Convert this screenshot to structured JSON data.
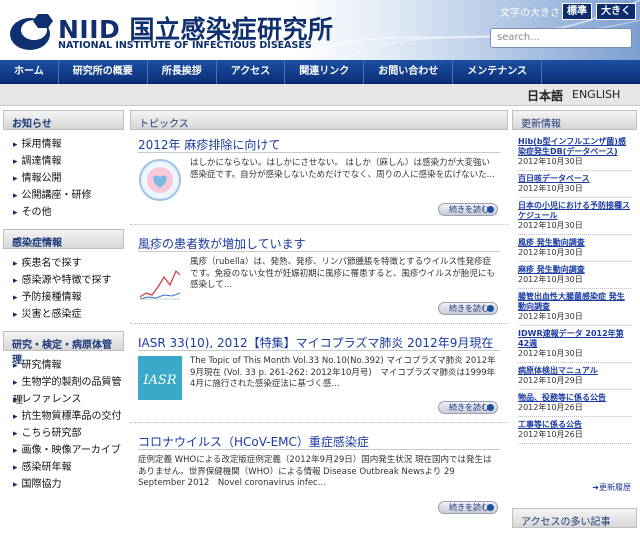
{
  "header": {
    "logo_name": "NIID 国立感染症研究所",
    "logo_sub": "NATIONAL INSTITUTE OF INFECTIOUS DISEASES",
    "font_size_label": "文字の大きさ",
    "font_standard": "標準",
    "font_large": "大きく",
    "search_placeholder": "search..."
  },
  "nav": [
    "ホーム",
    "研究所の概要",
    "所長挨拶",
    "アクセス",
    "関連リンク",
    "お問い合わせ",
    "メンテナンス"
  ],
  "lang": {
    "ja": "日本語",
    "en": "ENGLISH"
  },
  "left": {
    "sections": [
      {
        "title": "お知らせ",
        "items": [
          "採用情報",
          "調達情報",
          "情報公開",
          "公開講座・研修",
          "その他"
        ]
      },
      {
        "title": "感染症情報",
        "items": [
          "疾患名で探す",
          "感染源や特徴で探す",
          "予防接種情報",
          "災害と感染症"
        ]
      },
      {
        "title": "研究・検定・病原体管理",
        "items": [
          "研究情報",
          "生物学的製剤の品質管理",
          "レファレンス",
          "抗生物質標準品の交付",
          "こちら研究部",
          "画像・映像アーカイブ",
          "感染研年報",
          "国際協力"
        ]
      }
    ]
  },
  "topics": {
    "title": "トピックス",
    "items": [
      {
        "title": "2012年 麻疹排除に向けて",
        "text": "はしかにならない。はしかにさせない。 はしか（麻しん）は感染力が大変強い感染症です。自分が感染しないためだけでなく、周りの人に感染を広げないた...",
        "more": "続きを読む",
        "thumb": "measles-elimination-logo"
      },
      {
        "title": "風疹の患者数が増加しています",
        "text": "風疹（rubella）は、発熱、発疹、リンパ節腫脹を特徴とするウイルス性発疹症です。免疫のない女性が妊娠初期に風疹に罹患すると、風疹ウイルスが胎児にも感染して...",
        "more": "続きを読む",
        "thumb": "rubella-chart"
      },
      {
        "title": "IASR 33(10), 2012【特集】マイコプラズマ肺炎  2012年9月現在",
        "text": "The Topic of This Month Vol.33 No.10(No.392) マイコプラズマ肺炎 2012年9月現在 (Vol. 33 p. 261-262: 2012年10月号)　マイコプラズマ肺炎は1999年4月に施行された感染症法に基づく感...",
        "more": "続きを読む",
        "thumb": "iasr-logo"
      },
      {
        "title": "コロナウイルス（HCoV-EMC）重症感染症",
        "text": "症例定義 WHOによる改定版症例定義（2012年9月29日）国内発生状況 現在国内では発生はありません。世界保健機関（WHO）による情報 Disease Outbreak Newsより 29 September 2012　Novel coronavirus infec...",
        "more": "続きを読む",
        "thumb": ""
      }
    ]
  },
  "updates": {
    "title": "更新情報",
    "items": [
      {
        "title": "Hib(b型インフルエンザ菌)感染症発生DB(データベース)",
        "date": "2012年10月30日"
      },
      {
        "title": "百日咳データベース",
        "date": "2012年10月30日"
      },
      {
        "title": "日本の小児における予防接種スケジュール",
        "date": "2012年10月30日"
      },
      {
        "title": "風疹 発生動向調査",
        "date": "2012年10月30日"
      },
      {
        "title": "麻疹 発生動向調査",
        "date": "2012年10月30日"
      },
      {
        "title": "腸管出血性大腸菌感染症 発生動向調査",
        "date": "2012年10月30日"
      },
      {
        "title": "IDWR速報データ 2012年第42週",
        "date": "2012年10月30日"
      },
      {
        "title": "病原体検出マニュアル",
        "date": "2012年10月29日"
      },
      {
        "title": "物品、役務等に係る公告",
        "date": "2012年10月26日"
      },
      {
        "title": "工事等に係る公告",
        "date": "2012年10月26日"
      }
    ],
    "history": "更新履歴"
  },
  "access_title": "アクセスの多い記事"
}
